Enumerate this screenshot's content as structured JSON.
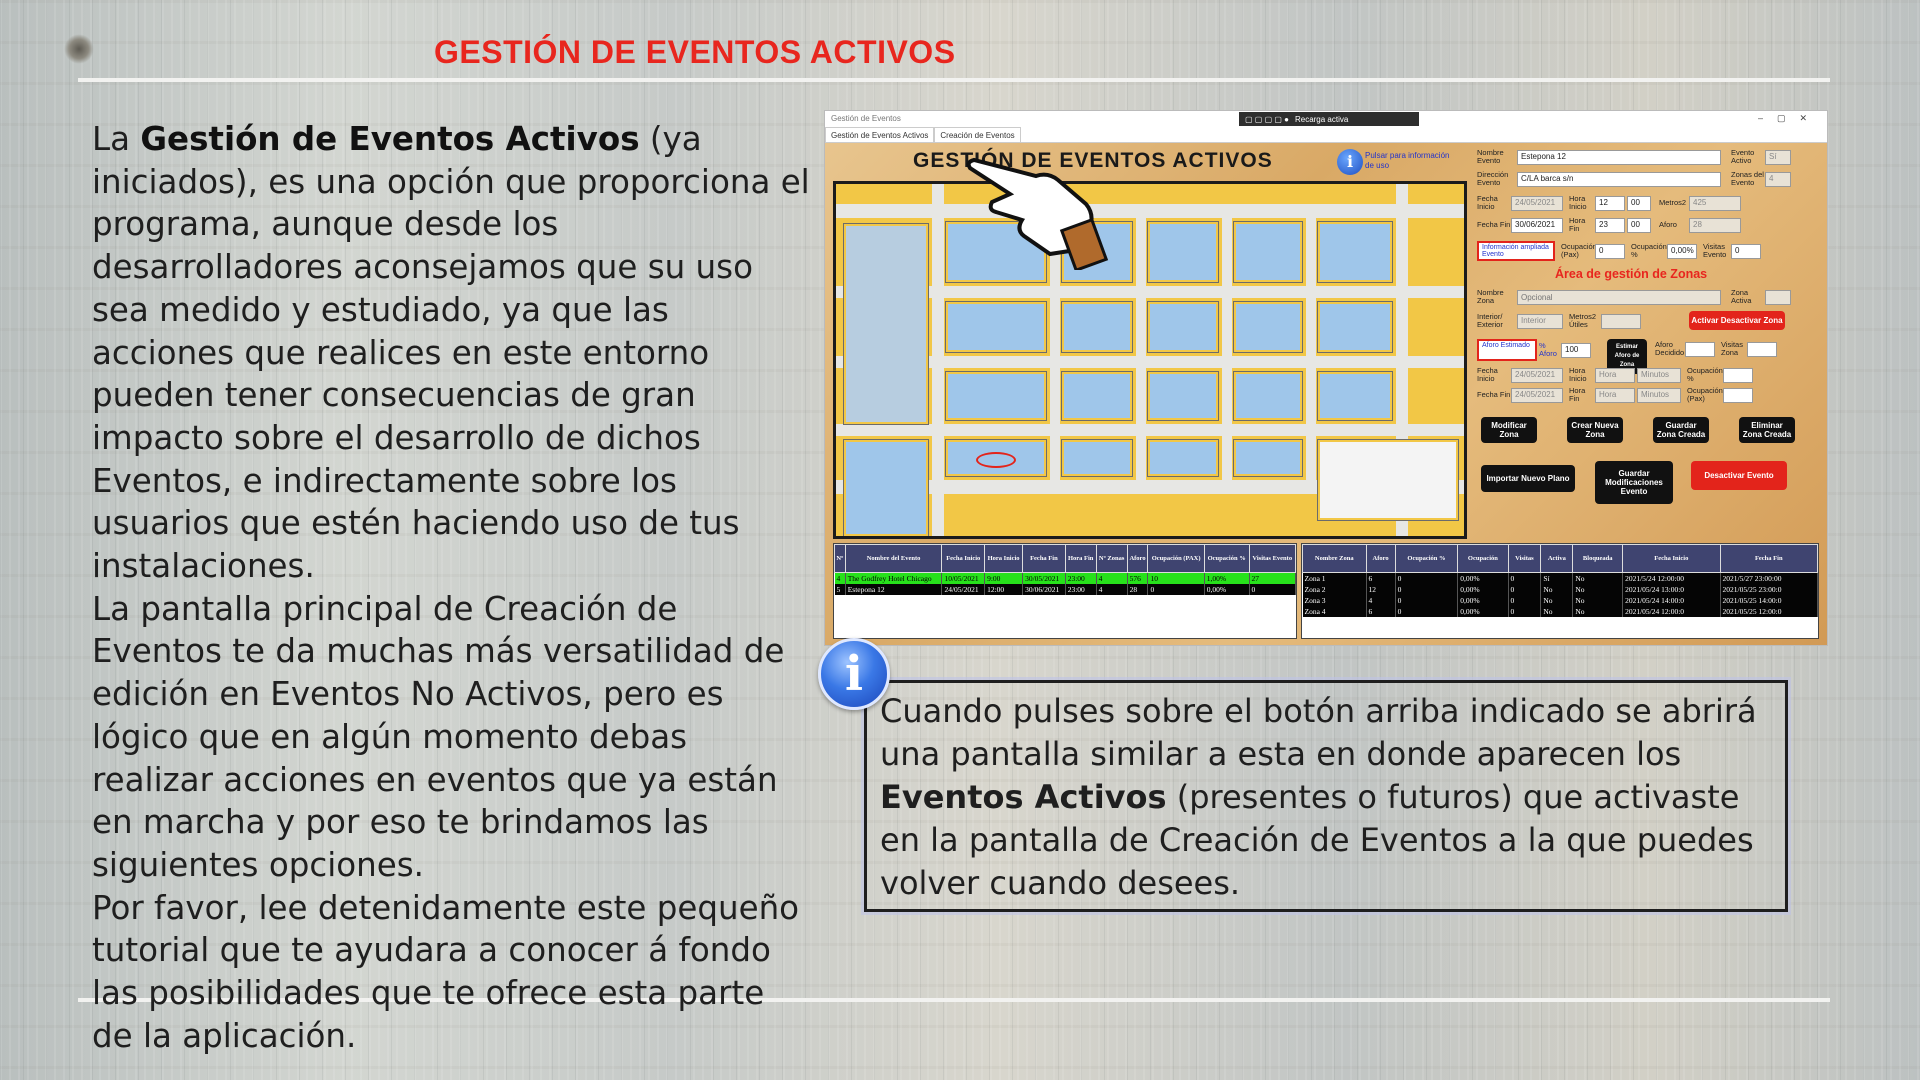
{
  "slide": {
    "title": "GESTIÓN DE EVENTOS ACTIVOS",
    "left_paragraph": {
      "p1_pre": "La ",
      "p1_bold": "Gestión de Eventos Activos",
      "p1_post": " (ya iniciados), es una opción que proporciona el programa, aunque desde los desarrolladores aconsejamos que su uso sea medido y estudiado, ya que las acciones que realices en este entorno pueden tener consecuencias de gran impacto sobre el desarrollo de dichos Eventos, e indirectamente sobre los usuarios que estén haciendo uso de tus instalaciones.",
      "p2": "La pantalla principal de Creación de Eventos te da muchas más versatilidad de edición en Eventos No Activos, pero es lógico que en algún momento debas realizar acciones en eventos que ya están en marcha y por eso te brindamos las siguientes opciones.",
      "p3": "Por favor, lee detenidamente este pequeño tutorial que te ayudara a conocer á fondo las posibilidades que te ofrece esta parte de la aplicación."
    },
    "callout": {
      "info_glyph": "i",
      "pre": "Cuando pulses sobre el botón arriba indicado se abrirá una pantalla similar a esta en donde aparecen los ",
      "bold": "Eventos Activos",
      "post": " (presentes o futuros) que activaste en la pantalla de Creación de Eventos a la que puedes volver cuando desees."
    }
  },
  "app": {
    "window_title": "Gestión de Eventos",
    "toolbar_label": "Recarga activa",
    "tabs": [
      "Gestión de Eventos Activos",
      "Creación de Eventos"
    ],
    "heading": "GESTIÓN DE EVENTOS ACTIVOS",
    "info_hint": "Pulsar para información de uso",
    "form": {
      "nombre_evento_label": "Nombre Evento",
      "nombre_evento_value": "Estepona 12",
      "evento_activo_label": "Evento Activo",
      "evento_activo_value": "Sí",
      "direccion_label": "Dirección Evento",
      "direccion_value": "C/LA barca s/n",
      "zonas_label": "Zonas del Evento",
      "zonas_value": "4",
      "fecha_inicio_label": "Fecha Inicio",
      "fecha_inicio_value": "24/05/2021",
      "hora_inicio_label": "Hora Inicio",
      "hora_inicio_h": "12",
      "hora_inicio_m": "00",
      "metros_label": "Metros2",
      "metros_value": "425",
      "fecha_fin_label": "Fecha Fin",
      "fecha_fin_value": "30/06/2021",
      "hora_fin_label": "Hora Fin",
      "hora_fin_h": "23",
      "hora_fin_m": "00",
      "aforo_label": "Aforo",
      "aforo_value": "28",
      "info_ampliada": "Información ampliada Evento",
      "ocupacion_pax_label": "Ocupación (Pax)",
      "ocupacion_pax_value": "0",
      "ocupacion_pct_label": "Ocupación %",
      "ocupacion_pct_value": "0,00%",
      "visitas_label": "Visitas Evento",
      "visitas_value": "0",
      "zonas_title": "Área de gestión de Zonas",
      "nombre_zona_label": "Nombre Zona",
      "nombre_zona_placeholder": "Opcional",
      "zona_activa_label": "Zona Activa",
      "int_ext_label": "Interior/ Exterior",
      "int_ext_value": "Interior",
      "metros_utiles_label": "Metros2 Útiles",
      "activar_zona": "Activar Desactivar Zona",
      "aforo_estimado_label": "Aforo Estimado",
      "pct_aforo_label": "% Aforo",
      "pct_aforo_value": "100",
      "estimar_aforo": "Estimar Aforo de Zona",
      "aforo_decidido_label": "Aforo Decidido",
      "visitas_zona_label": "Visitas Zona",
      "z_fecha_inicio_label": "Fecha Inicio",
      "z_fecha_inicio_value": "24/05/2021",
      "z_hora_inicio_label": "Hora Inicio",
      "z_hora_label": "Hora",
      "z_minutos_label": "Minutos",
      "z_ocupacion_pct_label": "Ocupación %",
      "z_fecha_fin_label": "Fecha Fin",
      "z_fecha_fin_value": "24/05/2021",
      "z_hora_fin_label": "Hora Fin",
      "z_ocupacion_pax_label": "Ocupación (Pax)",
      "btn_modificar_zona": "Modificar Zona",
      "btn_crear_zona": "Crear Nueva Zona",
      "btn_guardar_zona": "Guardar Zona Creada",
      "btn_eliminar_zona": "Eliminar Zona Creada",
      "btn_importar_plano": "Importar Nuevo Plano",
      "btn_guardar_mod": "Guardar Modificaciones Evento",
      "btn_desactivar": "Desactivar Evento"
    },
    "events_table": {
      "headers": [
        "Nº",
        "Nombre del Evento",
        "Fecha Inicio",
        "Hora Inicio",
        "Fecha Fin",
        "Hora Fin",
        "Nº Zonas",
        "Aforo",
        "Ocupación (PAX)",
        "Ocupación %",
        "Visitas Evento"
      ],
      "rows": [
        [
          "4",
          "The Godfrey Hotel Chicago",
          "10/05/2021",
          "9:00",
          "30/05/2021",
          "23:00",
          "4",
          "576",
          "10",
          "1,00%",
          "27"
        ],
        [
          "5",
          "Estepona 12",
          "24/05/2021",
          "12:00",
          "30/06/2021",
          "23:00",
          "4",
          "28",
          "0",
          "0,00%",
          "0"
        ]
      ]
    },
    "zones_table": {
      "headers": [
        "Nombre Zona",
        "Aforo",
        "Ocupación %",
        "Ocupación",
        "Visitas",
        "Activa",
        "Bloqueada",
        "Fecha Inicio",
        "Fecha Fin"
      ],
      "rows": [
        [
          "Zona 1",
          "6",
          "0",
          "0,00%",
          "0",
          "Sí",
          "No",
          "2021/5/24 12:00:00",
          "2021/5/27 23:00:00"
        ],
        [
          "Zona 2",
          "12",
          "0",
          "0,00%",
          "0",
          "No",
          "No",
          "2021/05/24 13:00:0",
          "2021/05/25 23:00:0"
        ],
        [
          "Zona 3",
          "4",
          "0",
          "0,00%",
          "0",
          "No",
          "No",
          "2021/05/24 14:00:0",
          "2021/05/25 14:00:0"
        ],
        [
          "Zona 4",
          "6",
          "0",
          "0,00%",
          "0",
          "No",
          "No",
          "2021/05/24 12:00:0",
          "2021/05/25 12:00:0"
        ]
      ]
    }
  },
  "colors": {
    "title_red": "#e8261e",
    "green_row": "#27e11b",
    "table_header": "#3f4470",
    "info_blue": "#2a5fd6"
  },
  "icons": {
    "pointer": "hand-pointer-icon",
    "info": "info-icon"
  }
}
